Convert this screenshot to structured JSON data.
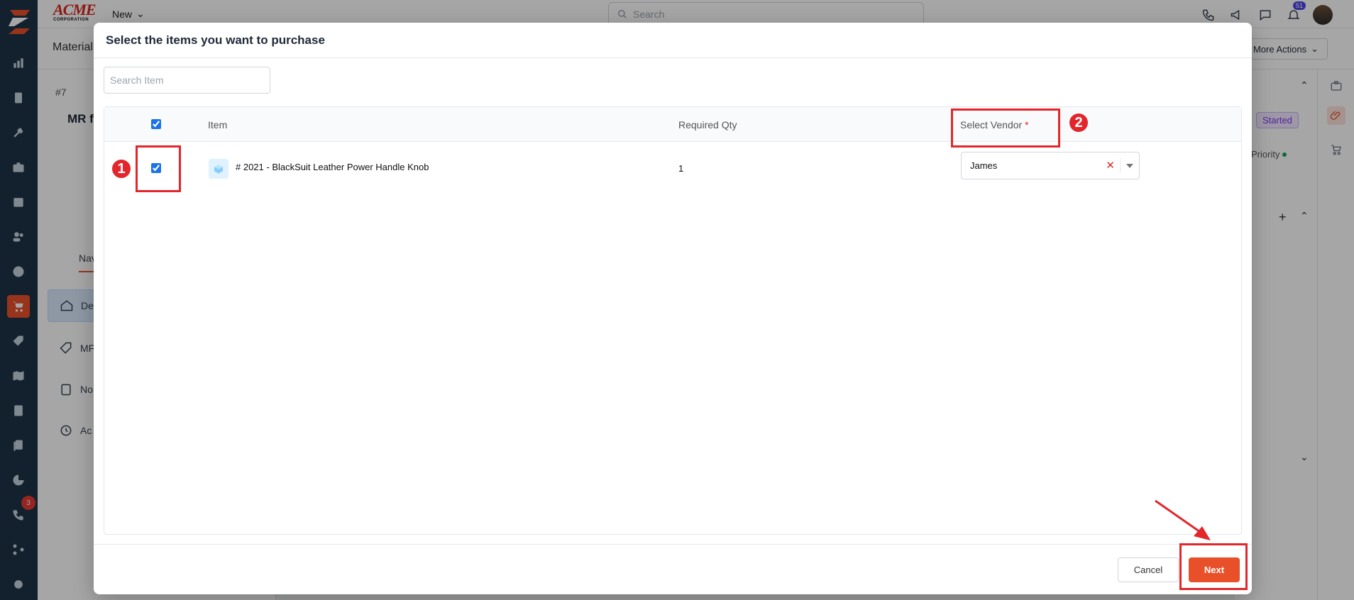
{
  "topbar": {
    "brand_name": "ACME",
    "brand_sub": "CORPORATION",
    "new_label": "New",
    "search_placeholder": "Search",
    "notification_count": "51"
  },
  "rail": {
    "badge_count": "3",
    "active_item": "cart-icon"
  },
  "background": {
    "page_title": "Material",
    "more_actions": "More Actions",
    "request_id": "#7",
    "request_title": "MR f",
    "nav_tab": "Nav",
    "left_nav": [
      "De",
      "MF",
      "No",
      "Ac"
    ],
    "status": "Started",
    "priority": "w Priority"
  },
  "modal": {
    "title": "Select the items you want to purchase",
    "search_placeholder": "Search Item",
    "columns": {
      "item": "Item",
      "required_qty": "Required Qty",
      "select_vendor": "Select Vendor",
      "required_mark": "*"
    },
    "rows": [
      {
        "checked": true,
        "item": "# 2021 - BlackSuit Leather Power Handle Knob",
        "qty": "1",
        "vendor": "James"
      }
    ],
    "cancel_label": "Cancel",
    "next_label": "Next"
  },
  "annotations": {
    "step1": "1",
    "step2": "2",
    "color": "#e3262b"
  },
  "colors": {
    "accent": "#e8502a",
    "rail": "#1d3346"
  }
}
